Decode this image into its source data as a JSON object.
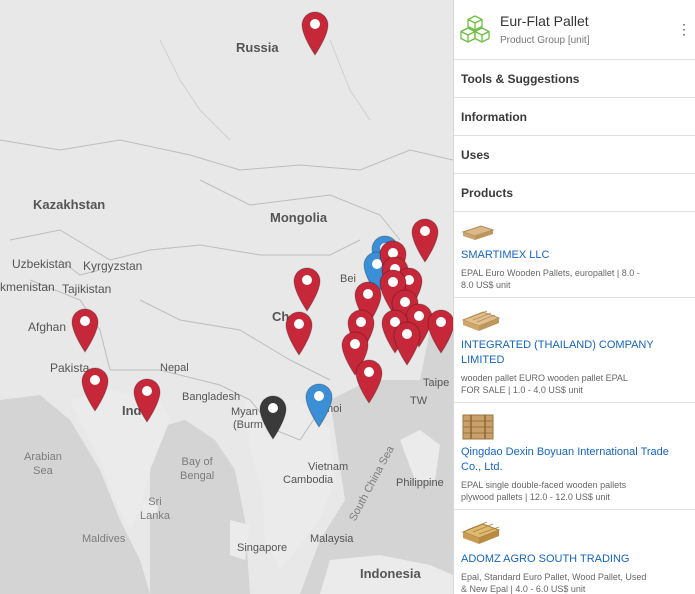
{
  "map": {
    "labels": {
      "russia": "Russia",
      "kazakhstan": "Kazakhstan",
      "mongolia": "Mongolia",
      "uzbekistan": "Uzbekistan",
      "kyrgyzstan": "Kyrgyzstan",
      "turkmenistan": "kmenistan",
      "tajikistan": "Tajikistan",
      "afghanistan": "Afghan",
      "pakistan": "Pakista",
      "india": "Ind",
      "nepal": "Nepal",
      "bangladesh": "Bangladesh",
      "myanmar": "Myan",
      "burma": "(Burm",
      "beijing": "Bei",
      "china": "Ch",
      "hanoi": "Hanoi",
      "taipei": "Taipe",
      "vietnam": "Vietnam",
      "cambodia": "Cambodia",
      "tw": "TW",
      "arabian_sea": "Arabian\nSea",
      "bay_of_bengal": "Bay of\nBengal",
      "south_china_sea": "South China Sea",
      "philippines": "Philippine",
      "sri_lanka": "Sri\nLanka",
      "maldives": "Maldives",
      "singapore": "Singapore",
      "malaysia": "Malaysia",
      "indonesia": "Indonesia"
    },
    "pin_colors": {
      "red": "#c62839",
      "blue": "#3b8fd6",
      "black": "#3a3a3a"
    },
    "pins": [
      {
        "color": "red"
      },
      {
        "color": "red"
      },
      {
        "color": "red"
      },
      {
        "color": "red"
      },
      {
        "color": "red"
      },
      {
        "color": "red"
      },
      {
        "color": "red"
      },
      {
        "color": "blue"
      },
      {
        "color": "blue"
      },
      {
        "color": "red"
      },
      {
        "color": "red"
      },
      {
        "color": "red"
      },
      {
        "color": "red"
      },
      {
        "color": "red"
      },
      {
        "color": "red"
      },
      {
        "color": "red"
      },
      {
        "color": "red"
      },
      {
        "color": "red"
      },
      {
        "color": "red"
      },
      {
        "color": "red"
      },
      {
        "color": "red"
      },
      {
        "color": "black"
      },
      {
        "color": "blue"
      },
      {
        "color": "red"
      }
    ]
  },
  "panel": {
    "title": "Eur-Flat Pallet",
    "subtitle": "Product Group [unit]",
    "more_icon": "more-vertical-icon",
    "sections": [
      "Tools & Suggestions",
      "Information",
      "Uses",
      "Products"
    ],
    "products": [
      {
        "name": "SMARTIMEX LLC",
        "desc": "EPAL Euro Wooden Pallets, europallet | 8.0 -\n8.0 US$ unit"
      },
      {
        "name": "INTEGRATED (THAILAND) COMPANY LIMITED",
        "desc": "wooden pallet EURO wooden pallet EPAL\nFOR SALE | 1.0 - 4.0 US$ unit"
      },
      {
        "name": "Qingdao Dexin Boyuan International Trade Co., Ltd.",
        "desc": "EPAL single double-faced wooden pallets\nplywood pallets | 12.0 - 12.0 US$ unit"
      },
      {
        "name": "ADOMZ AGRO SOUTH TRADING",
        "desc": "Epal, Standard Euro Pallet, Wood Pallet, Used\n& New Epal | 4.0 - 6.0 US$ unit"
      }
    ],
    "logo_color": "#6cbf3f",
    "link_color": "#1565c0"
  }
}
